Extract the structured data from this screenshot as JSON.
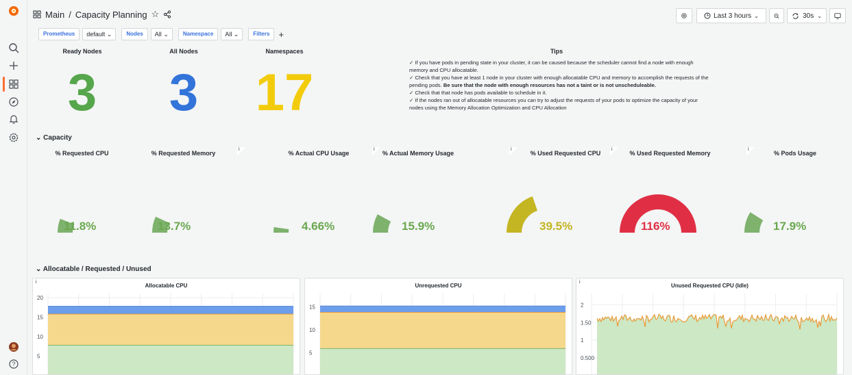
{
  "app": {
    "breadcrumb_root": "Main",
    "breadcrumb_separator": "/",
    "dashboard_title": "Capacity Planning",
    "time_range": "Last 3 hours",
    "refresh_interval": "30s"
  },
  "variables": [
    {
      "label": "Prometheus",
      "value": "default"
    },
    {
      "label": "Nodes",
      "value": "All"
    },
    {
      "label": "Namespace",
      "value": "All"
    },
    {
      "label": "Filters",
      "value": ""
    }
  ],
  "stats": {
    "ready_nodes": {
      "title": "Ready Nodes",
      "value": "3",
      "color": "#56a64b"
    },
    "all_nodes": {
      "title": "All Nodes",
      "value": "3",
      "color": "#3274d9"
    },
    "namespaces": {
      "title": "Namespaces",
      "value": "17",
      "color": "#f2cc0c"
    }
  },
  "tips": {
    "title": "Tips",
    "line1": "✓ If you have pods in pending state in your cluster, it can be caused because the scheduler cannot find a node with enough memory and CPU allocatable.",
    "line2_a": "✓ Check that you have at least 1 node in your cluster with enough allocatable CPU and memory to accomplish the requests of the pending pods.",
    "line2_b": "Be sure that the node with enough resources has not a taint or is not unscheduleable.",
    "line3": "✓ Check that that node has pods available to schedule in it.",
    "line4": "✓ If the nodes ran out of allocatable resources you can try to adjust the requests of your pods to optimize the capacity of your nodes using the Memory Allocation Optimization and CPU Allocation"
  },
  "rows": {
    "capacity": "Capacity",
    "allocatable": "Allocatable / Requested / Unused"
  },
  "gauges": [
    {
      "title": "% Requested CPU",
      "value": "11.8%",
      "percent": 11.8,
      "color": "#7eb26d",
      "info": false
    },
    {
      "title": "% Requested Memory",
      "value": "13.7%",
      "percent": 13.7,
      "color": "#7eb26d",
      "info": false
    },
    {
      "title": "% Actual CPU Usage",
      "value": "4.66%",
      "percent": 4.66,
      "color": "#7eb26d",
      "info": true
    },
    {
      "title": "% Actual Memory Usage",
      "value": "15.9%",
      "percent": 15.9,
      "color": "#7eb26d",
      "info": true
    },
    {
      "title": "% Used Requested CPU",
      "value": "39.5%",
      "percent": 39.5,
      "color": "#c4b522",
      "info": true
    },
    {
      "title": "% Used Requested Memory",
      "value": "116%",
      "percent": 100,
      "color": "#e02f44",
      "info": true
    },
    {
      "title": "% Pods Usage",
      "value": "17.9%",
      "percent": 17.9,
      "color": "#7eb26d",
      "info": true
    }
  ],
  "charts": [
    {
      "title": "Allocatable CPU",
      "info": "i",
      "yticks": [
        "20",
        "15",
        "10",
        "5"
      ],
      "ymax": 20,
      "layers": [
        17.8,
        15.8,
        7.8
      ]
    },
    {
      "title": "Unrequested CPU",
      "info": "",
      "yticks": [
        "15",
        "10",
        "5"
      ],
      "ymax": 17,
      "layers": [
        15.2,
        13.8,
        5.9
      ]
    },
    {
      "title": "Unused Requested CPU (Idle)",
      "info": "i",
      "yticks": [
        "2",
        "1.50",
        "1",
        "0.500"
      ],
      "ymax": 2.2,
      "layers": [
        1.6
      ]
    }
  ],
  "colors": {
    "blue": "#6d9eeb",
    "orange": "#e89a36",
    "yellow_fill": "#f5d88c",
    "green_fill": "#cde8c4",
    "green_line": "#7eb26d"
  }
}
